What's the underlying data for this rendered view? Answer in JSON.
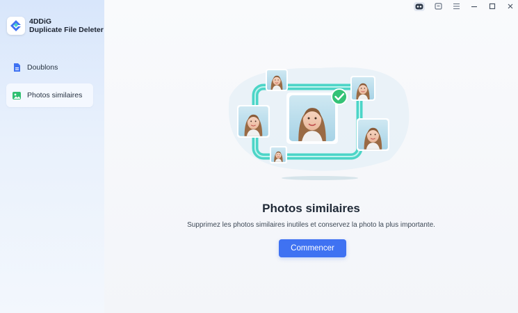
{
  "app": {
    "name_line1": "4DDiG",
    "name_line2": "Duplicate File Deleter"
  },
  "sidebar": {
    "items": [
      {
        "label": "Doublons",
        "icon": "file-icon",
        "color": "#3f72f2"
      },
      {
        "label": "Photos similaires",
        "icon": "image-icon",
        "color": "#2fbf71",
        "selected": true
      }
    ]
  },
  "window_controls": [
    "assistant-icon",
    "feedback-icon",
    "menu-icon",
    "minimize-icon",
    "maximize-icon",
    "close-icon"
  ],
  "main": {
    "title": "Photos similaires",
    "subtitle": "Supprimez les photos similaires inutiles et conservez la photo la plus importante.",
    "start_button": "Commencer"
  },
  "colors": {
    "accent": "#3f72f2",
    "teal": "#43d3c4",
    "check": "#34c276"
  }
}
